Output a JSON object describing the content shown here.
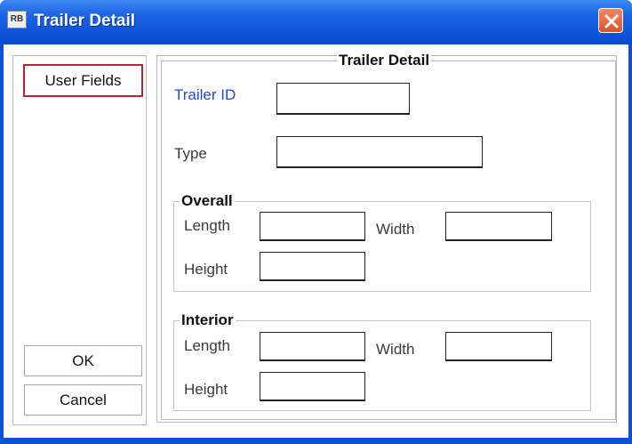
{
  "window": {
    "title": "Trailer Detail",
    "icon_name": "app-icon",
    "icon_text": "RB"
  },
  "left": {
    "user_fields": "User Fields",
    "ok": "OK",
    "cancel": "Cancel"
  },
  "detail": {
    "legend": "Trailer Detail",
    "trailer_id_label": "Trailer ID",
    "trailer_id_value": "",
    "type_label": "Type",
    "type_value": ""
  },
  "overall": {
    "legend": "Overall",
    "length_label": "Length",
    "length_value": "",
    "width_label": "Width",
    "width_value": "",
    "height_label": "Height",
    "height_value": ""
  },
  "interior": {
    "legend": "Interior",
    "length_label": "Length",
    "length_value": "",
    "width_label": "Width",
    "width_value": "",
    "height_label": "Height",
    "height_value": ""
  },
  "colors": {
    "title_bar": "#0b55d9",
    "user_fields_border": "#b8222e",
    "trailer_id_label": "#2246e0"
  }
}
